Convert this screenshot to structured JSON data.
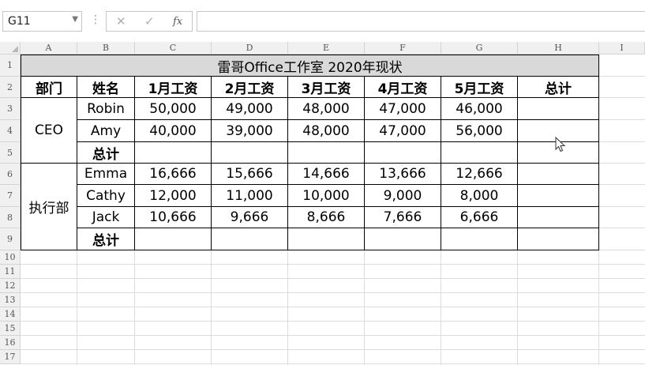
{
  "formula_bar": {
    "name_box": "G11",
    "formula_value": ""
  },
  "icons": {
    "name_box_dropdown": "chevron-down-icon",
    "cancel": "cancel-icon",
    "enter": "check-icon",
    "fx": "function-icon"
  },
  "colors": {
    "title_fill": "#d9d9d9",
    "header_fill": "#f0f0f0",
    "gridline": "#dcdcdc",
    "border": "#000000"
  },
  "sheet": {
    "columns": [
      "A",
      "B",
      "C",
      "D",
      "E",
      "F",
      "G",
      "H",
      "I"
    ],
    "rows": [
      "1",
      "2",
      "3",
      "4",
      "5",
      "6",
      "7",
      "8",
      "9",
      "10",
      "11",
      "12",
      "13",
      "14",
      "15",
      "16",
      "17"
    ],
    "title": "雷哥Office工作室 2020年现状",
    "headers": [
      "部门",
      "姓名",
      "1月工资",
      "2月工资",
      "3月工资",
      "4月工资",
      "5月工资",
      "总计"
    ],
    "groups": [
      {
        "dept": "CEO",
        "rows": [
          {
            "name": "Robin",
            "values": [
              "50,000",
              "49,000",
              "48,000",
              "47,000",
              "46,000"
            ],
            "total": ""
          },
          {
            "name": "Amy",
            "values": [
              "40,000",
              "39,000",
              "48,000",
              "47,000",
              "56,000"
            ],
            "total": ""
          }
        ],
        "subtotal_label": "总计"
      },
      {
        "dept": "执行部",
        "rows": [
          {
            "name": "Emma",
            "values": [
              "16,666",
              "15,666",
              "14,666",
              "13,666",
              "12,666"
            ],
            "total": ""
          },
          {
            "name": "Cathy",
            "values": [
              "12,000",
              "11,000",
              "10,000",
              "9,000",
              "8,000"
            ],
            "total": ""
          },
          {
            "name": "Jack",
            "values": [
              "10,666",
              "9,666",
              "8,666",
              "7,666",
              "6,666"
            ],
            "total": ""
          }
        ],
        "subtotal_label": "总计"
      }
    ]
  },
  "fx_label": "fx",
  "cancel_glyph": "✕",
  "enter_glyph": "✓",
  "dots_glyph": "⋮"
}
